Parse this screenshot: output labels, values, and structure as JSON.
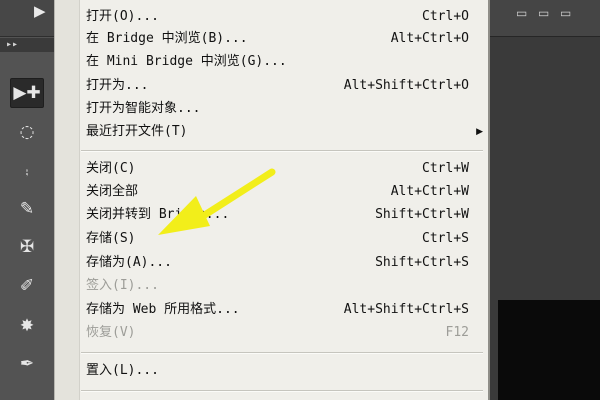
{
  "app": {
    "panel_header": "▸▸"
  },
  "tools": [
    {
      "name": "move-tool",
      "glyph": "▶✚"
    },
    {
      "name": "marquee-tool",
      "glyph": "◌"
    },
    {
      "name": "lasso-tool",
      "glyph": "⨾"
    },
    {
      "name": "quick-selection-tool",
      "glyph": "✎"
    },
    {
      "name": "crop-tool",
      "glyph": "✠"
    },
    {
      "name": "eyedropper-tool",
      "glyph": "✐"
    },
    {
      "name": "healing-brush-tool",
      "glyph": "✸"
    },
    {
      "name": "brush-tool",
      "glyph": "✒"
    }
  ],
  "menu": {
    "items": [
      {
        "label": "打开(O)...",
        "shortcut": "Ctrl+O",
        "enabled": true
      },
      {
        "label": "在 Bridge 中浏览(B)...",
        "shortcut": "Alt+Ctrl+O",
        "enabled": true
      },
      {
        "label": "在 Mini Bridge 中浏览(G)...",
        "shortcut": "",
        "enabled": true
      },
      {
        "label": "打开为...",
        "shortcut": "Alt+Shift+Ctrl+O",
        "enabled": true
      },
      {
        "label": "打开为智能对象...",
        "shortcut": "",
        "enabled": true
      },
      {
        "label": "最近打开文件(T)",
        "shortcut": "",
        "enabled": true,
        "submenu": true
      },
      {
        "label": "关闭(C)",
        "shortcut": "Ctrl+W",
        "enabled": true
      },
      {
        "label": "关闭全部",
        "shortcut": "Alt+Ctrl+W",
        "enabled": true
      },
      {
        "label": "关闭并转到 Bridge...",
        "shortcut": "Shift+Ctrl+W",
        "enabled": true
      },
      {
        "label": "存储(S)",
        "shortcut": "Ctrl+S",
        "enabled": true
      },
      {
        "label": "存储为(A)...",
        "shortcut": "Shift+Ctrl+S",
        "enabled": true
      },
      {
        "label": "签入(I)...",
        "shortcut": "",
        "enabled": false
      },
      {
        "label": "存储为 Web 所用格式...",
        "shortcut": "Alt+Shift+Ctrl+S",
        "enabled": true
      },
      {
        "label": "恢复(V)",
        "shortcut": "F12",
        "enabled": false
      },
      {
        "label": "置入(L)...",
        "shortcut": "",
        "enabled": true
      }
    ]
  },
  "annotation": {
    "color": "#f2ee1a"
  }
}
